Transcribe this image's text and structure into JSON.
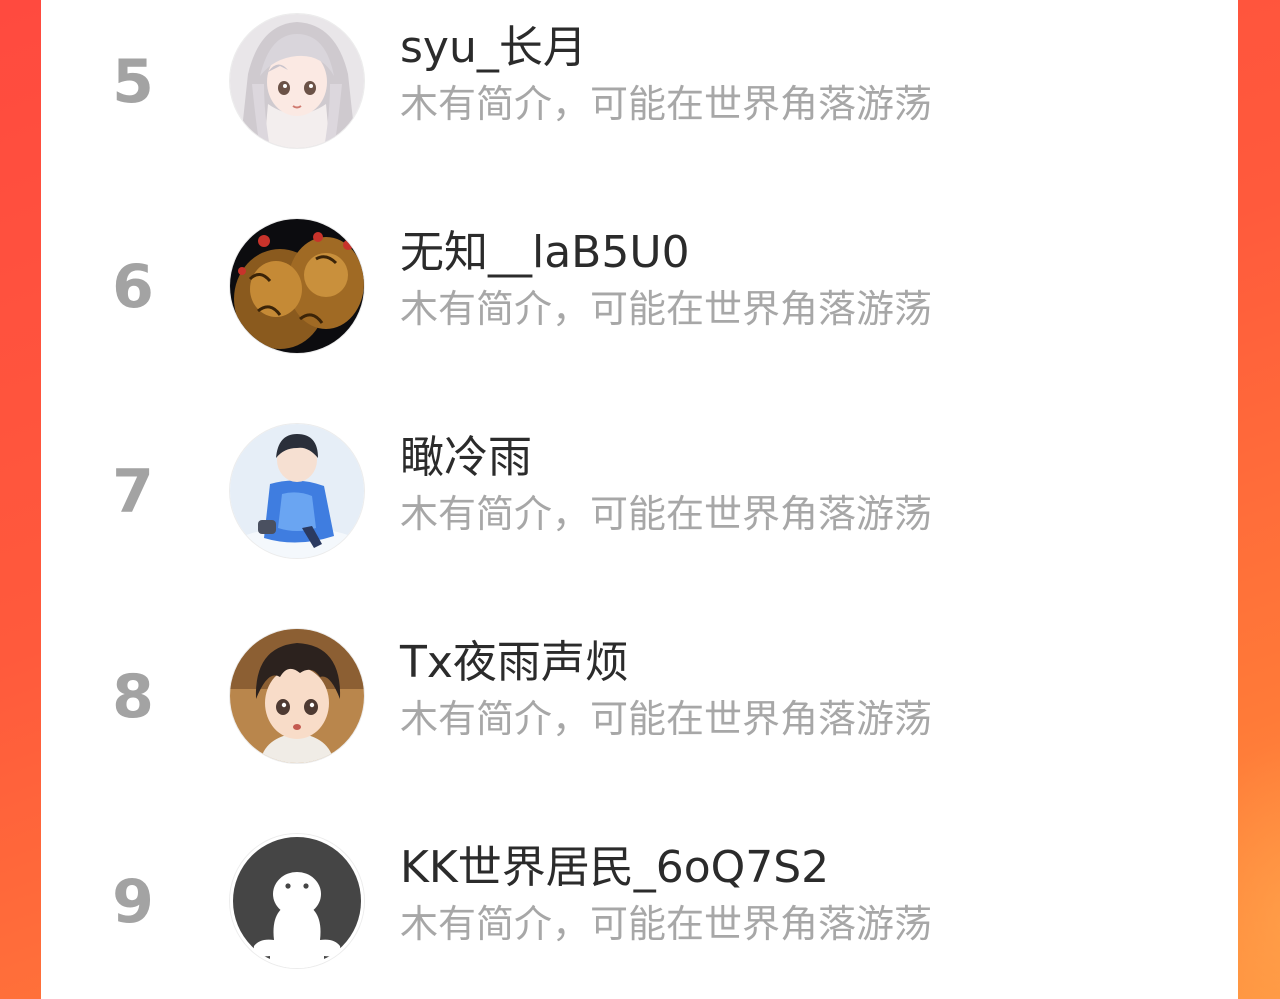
{
  "theme": {
    "accent_left": "#ff4a3f",
    "accent_right": "#ff8a3c",
    "card_bg": "#ffffff",
    "rank_color": "#a3a3a3",
    "name_color": "#2b2b2b",
    "bio_color": "#a7a7a7"
  },
  "ranking": {
    "items": [
      {
        "rank": "5",
        "name": "syu_长月",
        "bio": "木有简介，可能在世界角落游荡",
        "avatar_icon": "anime-girl-silver-hair-avatar"
      },
      {
        "rank": "6",
        "name": "无知__laB5U0",
        "bio": "木有简介，可能在世界角落游荡",
        "avatar_icon": "golden-lion-dance-avatar"
      },
      {
        "rank": "7",
        "name": "瞰冷雨",
        "bio": "木有简介，可能在世界角落游荡",
        "avatar_icon": "boy-blue-coat-snow-avatar"
      },
      {
        "rank": "8",
        "name": "Tx夜雨声烦",
        "bio": "木有简介，可能在世界角落游荡",
        "avatar_icon": "anime-boy-dark-hair-avatar"
      },
      {
        "rank": "9",
        "name": "KK世界居民_6oQ7S2",
        "bio": "木有简介，可能在世界角落游荡",
        "avatar_icon": "default-ghost-avatar"
      }
    ]
  }
}
